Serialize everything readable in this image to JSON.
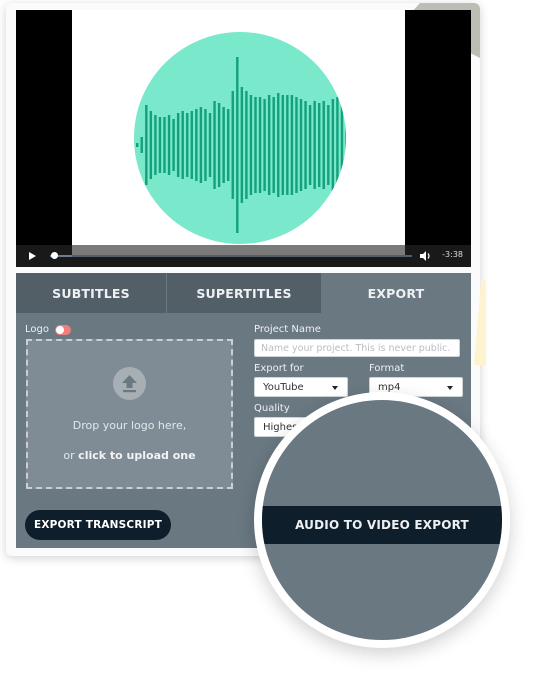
{
  "player": {
    "time_remaining": "-3:38",
    "progress_fraction": 0.01,
    "buffered_fraction": 0.06,
    "play_icon": "play-icon",
    "volume_icon": "volume-icon",
    "waveform_color": "#13a07a",
    "disc_color": "#79e8cb"
  },
  "tabs": [
    {
      "label": "SUBTITLES",
      "active": false
    },
    {
      "label": "SUPERTITLES",
      "active": false
    },
    {
      "label": "EXPORT",
      "active": true
    }
  ],
  "export_panel": {
    "logo_label": "Logo",
    "logo_toggle_on": false,
    "dropzone": {
      "icon": "upload-icon",
      "line1": "Drop your logo here,",
      "line2_prefix": "or ",
      "line2_link": "click to upload one"
    },
    "project_name": {
      "label": "Project Name",
      "placeholder": "Name your project. This is never public.",
      "value": ""
    },
    "export_for": {
      "label": "Export for",
      "value": "YouTube"
    },
    "format": {
      "label": "Format",
      "value": "mp4"
    },
    "quality": {
      "label": "Quality",
      "value": "Highest"
    },
    "export_transcript_label": "EXPORT TRANSCRIPT",
    "audio_to_video_label": "AUDIO TO VIDEO EXPORT"
  }
}
